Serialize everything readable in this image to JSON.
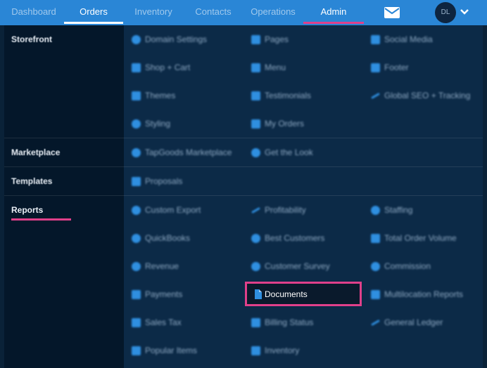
{
  "nav": {
    "items": [
      "Dashboard",
      "Orders",
      "Inventory",
      "Contacts",
      "Operations",
      "Admin"
    ],
    "avatar_initials": "DL",
    "mail_icon": "mail-icon",
    "chevron_icon": "chevron-down-icon"
  },
  "sections": {
    "storefront": "Storefront",
    "marketplace": "Marketplace",
    "templates": "Templates",
    "reports": "Reports"
  },
  "storefront": {
    "col1": [
      "Domain Settings",
      "Shop + Cart",
      "Themes",
      "Styling"
    ],
    "col2": [
      "Pages",
      "Menu",
      "Testimonials",
      "My Orders"
    ],
    "col3": [
      "Social Media",
      "Footer",
      "Global SEO + Tracking"
    ]
  },
  "marketplace": {
    "items": [
      "TapGoods Marketplace",
      "Get the Look"
    ]
  },
  "templates": {
    "items": [
      "Proposals"
    ]
  },
  "reports": {
    "col1": [
      "Custom Export",
      "QuickBooks",
      "Revenue",
      "Payments",
      "Sales Tax",
      "Popular Items"
    ],
    "col2": [
      "Profitability",
      "Best Customers",
      "Customer Survey",
      "Documents",
      "Billing Status",
      "Inventory"
    ],
    "col3": [
      "Staffing",
      "Total Order Volume",
      "Commission",
      "Multilocation Reports",
      "General Ledger"
    ]
  },
  "colors": {
    "nav_bg": "#2a86d6",
    "accent": "#e0408a",
    "panel_bg": "#0c2a47",
    "sidebar_bg": "#04172a",
    "icon_blue": "#2f8fe0"
  }
}
